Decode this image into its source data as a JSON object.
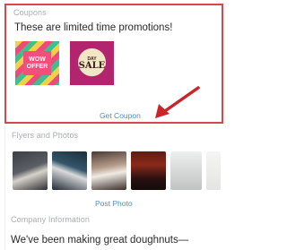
{
  "coupons": {
    "section_label": "Coupons",
    "headline": "These are limited time promotions!",
    "items": [
      {
        "line1": "WOW",
        "line2": "OFFER",
        "name": "wow-offer"
      },
      {
        "line1": "SALE",
        "line2": "DAY",
        "name": "sale-day"
      }
    ],
    "link_label": "Get Coupon",
    "annotation_color": "#c9252b"
  },
  "flyers": {
    "section_label": "Flyers and Photos",
    "link_label": "Post Photo"
  },
  "company": {
    "section_label": "Company Information",
    "description": "We've been making great doughnuts—"
  },
  "colors": {
    "highlight_border": "#d9474a",
    "link": "#4a8fd9",
    "section_label": "#a8adb3"
  }
}
